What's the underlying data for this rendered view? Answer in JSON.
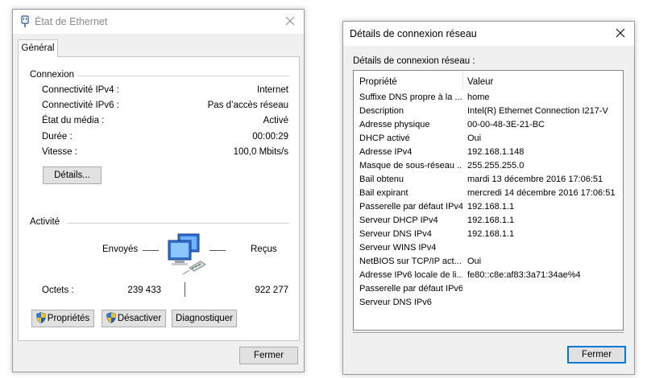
{
  "ethernet_status": {
    "title": "État de Ethernet",
    "tab": "Général",
    "connection": {
      "group_title": "Connexion",
      "rows": [
        {
          "label": "Connectivité IPv4 :",
          "value": "Internet"
        },
        {
          "label": "Connectivité IPv6 :",
          "value": "Pas d’accès réseau"
        },
        {
          "label": "État du média :",
          "value": "Activé"
        },
        {
          "label": "Durée :",
          "value": "00:00:29"
        },
        {
          "label": "Vitesse :",
          "value": "100,0 Mbits/s"
        }
      ],
      "details_button": "Détails..."
    },
    "activity": {
      "group_title": "Activité",
      "sent_label": "Envoyés",
      "received_label": "Reçus",
      "bytes_label": "Octets :",
      "bytes_sent": "239 433",
      "bytes_received": "922 277"
    },
    "buttons": {
      "properties": "Propriétés",
      "disable": "Désactiver",
      "diagnose": "Diagnostiquer",
      "close": "Fermer"
    }
  },
  "details": {
    "title": "Détails de connexion réseau",
    "list_label": "Détails de connexion réseau :",
    "columns": {
      "property": "Propriété",
      "value": "Valeur"
    },
    "rows": [
      {
        "property": "Suffixe DNS propre à la ...",
        "value": "home"
      },
      {
        "property": "Description",
        "value": "Intel(R) Ethernet Connection I217-V"
      },
      {
        "property": "Adresse physique",
        "value": "00-00-48-3E-21-BC"
      },
      {
        "property": "DHCP activé",
        "value": "Oui"
      },
      {
        "property": "Adresse IPv4",
        "value": "192.168.1.148"
      },
      {
        "property": "Masque de sous-réseau ...",
        "value": "255.255.255.0"
      },
      {
        "property": "Bail obtenu",
        "value": "mardi 13 décembre 2016 17:06:51"
      },
      {
        "property": "Bail expirant",
        "value": "mercredi 14 décembre 2016 17:06:51"
      },
      {
        "property": "Passerelle par défaut IPv4",
        "value": "192.168.1.1"
      },
      {
        "property": "Serveur DHCP IPv4",
        "value": "192.168.1.1"
      },
      {
        "property": "Serveur DNS IPv4",
        "value": "192.168.1.1"
      },
      {
        "property": "Serveur WINS IPv4",
        "value": ""
      },
      {
        "property": "NetBIOS sur TCP/IP act...",
        "value": "Oui"
      },
      {
        "property": "Adresse IPv6 locale de li...",
        "value": "fe80::c8e:af83:3a71:34ae%4"
      },
      {
        "property": "Passerelle par défaut IPv6",
        "value": ""
      },
      {
        "property": "Serveur DNS IPv6",
        "value": ""
      }
    ],
    "close_button": "Fermer"
  },
  "colors": {
    "accent": "#0078d7",
    "dialog_bg": "#f0f0f0"
  }
}
